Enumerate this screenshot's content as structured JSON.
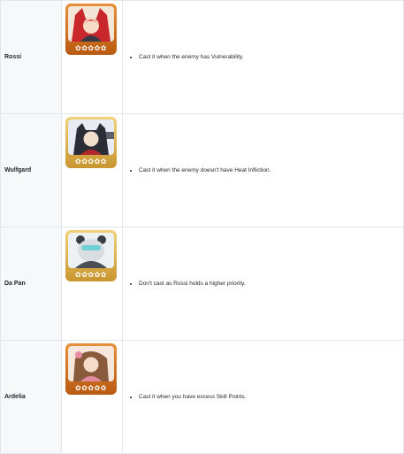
{
  "characters": [
    {
      "name": "Rossi",
      "tip": "Cast it when the enemy has Vulnerability.",
      "frame_color": "#d07a2a",
      "stars_text": "✿✿✿✿✿",
      "portrait_icon": "rossi-portrait-icon"
    },
    {
      "name": "Wulfgard",
      "tip": "Cast it when the enemy doesn't have Heat Infliction.",
      "frame_color": "#d8aa3f",
      "stars_text": "✿✿✿✿✿",
      "portrait_icon": "wulfgard-portrait-icon"
    },
    {
      "name": "Da Pan",
      "tip": "Don't cast as Rossi holds a higher priority.",
      "frame_color": "#d8aa3f",
      "stars_text": "✿✿✿✿✿",
      "portrait_icon": "da-pan-portrait-icon"
    },
    {
      "name": "Ardelia",
      "tip": "Cast it when you have excess Skill Points.",
      "frame_color": "#d07a2a",
      "stars_text": "✿✿✿✿✿",
      "portrait_icon": "ardelia-portrait-icon"
    }
  ]
}
